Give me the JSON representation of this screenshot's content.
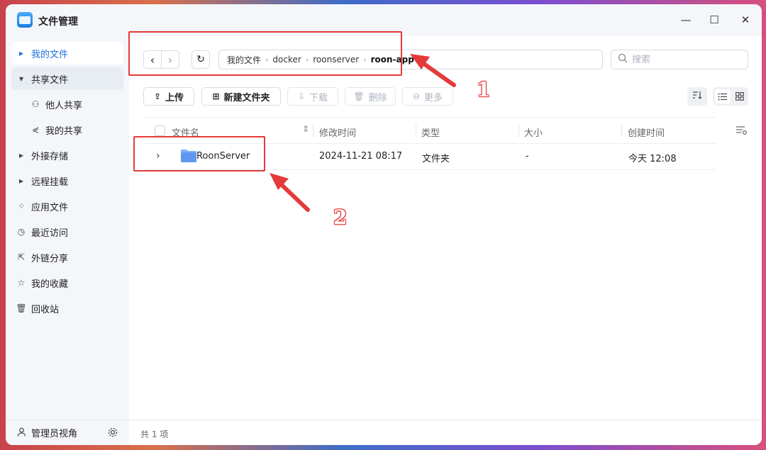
{
  "app": {
    "title": "文件管理"
  },
  "window_controls": {
    "minimize": "—",
    "maximize": "☐",
    "close": "✕"
  },
  "sidebar": {
    "items": [
      {
        "label": "我的文件",
        "icon": "caret-right-icon",
        "glyph": "▸"
      },
      {
        "label": "共享文件",
        "icon": "caret-down-icon",
        "glyph": "▾"
      },
      {
        "label": "他人共享",
        "icon": "users-icon",
        "glyph": "⚇"
      },
      {
        "label": "我的共享",
        "icon": "share-icon",
        "glyph": "⋞"
      },
      {
        "label": "外接存储",
        "icon": "caret-right-icon",
        "glyph": "▸"
      },
      {
        "label": "远程挂载",
        "icon": "caret-right-icon",
        "glyph": "▸"
      },
      {
        "label": "应用文件",
        "icon": "apps-grid-icon",
        "glyph": "⁘"
      },
      {
        "label": "最近访问",
        "icon": "clock-icon",
        "glyph": "◷"
      },
      {
        "label": "外链分享",
        "icon": "external-link-icon",
        "glyph": "⇱"
      },
      {
        "label": "我的收藏",
        "icon": "star-icon",
        "glyph": "☆"
      },
      {
        "label": "回收站",
        "icon": "trash-icon",
        "glyph": "🗑"
      }
    ],
    "bottom": {
      "label": "管理员视角",
      "icon": "user-icon",
      "settings_icon": "gear-icon"
    }
  },
  "nav": {
    "back": "‹",
    "forward": "›",
    "refresh": "↻"
  },
  "breadcrumb": [
    "我的文件",
    "docker",
    "roonserver",
    "roon-app"
  ],
  "search": {
    "placeholder": "搜索"
  },
  "toolbar": {
    "upload": "上传",
    "new_folder": "新建文件夹",
    "download": "下载",
    "delete": "删除",
    "more": "更多"
  },
  "table": {
    "headers": {
      "name": "文件名",
      "modified": "修改时间",
      "type": "类型",
      "size": "大小",
      "created": "创建时间"
    },
    "rows": [
      {
        "name": "RoonServer",
        "modified": "2024-11-21 08:17",
        "type": "文件夹",
        "size": "-",
        "created": "今天 12:08"
      }
    ]
  },
  "status": {
    "count_text": "共 1 项"
  },
  "annotations": {
    "label1": "1",
    "label2": "2",
    "color": "#e53a3a"
  }
}
